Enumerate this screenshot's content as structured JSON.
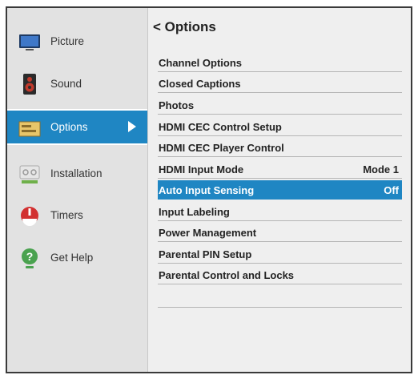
{
  "sidebar": {
    "items": [
      {
        "label": "Picture",
        "icon": "tv-icon",
        "active": false
      },
      {
        "label": "Sound",
        "icon": "speaker-icon",
        "active": false
      },
      {
        "label": "Options",
        "icon": "options-icon",
        "active": true
      },
      {
        "label": "Installation",
        "icon": "installation-icon",
        "active": false
      },
      {
        "label": "Timers",
        "icon": "timer-icon",
        "active": false
      },
      {
        "label": "Get Help",
        "icon": "help-icon",
        "active": false
      }
    ]
  },
  "main": {
    "back_symbol": "<",
    "title": "Options",
    "items": [
      {
        "label": "Channel Options",
        "value": ""
      },
      {
        "label": "Closed Captions",
        "value": ""
      },
      {
        "label": "Photos",
        "value": ""
      },
      {
        "label": "HDMI CEC Control Setup",
        "value": ""
      },
      {
        "label": "HDMI CEC Player Control",
        "value": ""
      },
      {
        "label": "HDMI Input Mode",
        "value": "Mode 1"
      },
      {
        "label": "Auto Input Sensing",
        "value": "Off",
        "selected": true
      },
      {
        "label": "Input Labeling",
        "value": ""
      },
      {
        "label": "Power Management",
        "value": ""
      },
      {
        "label": "Parental PIN Setup",
        "value": ""
      },
      {
        "label": "Parental Control and Locks",
        "value": ""
      }
    ]
  },
  "colors": {
    "accent": "#1f86c3",
    "background": "#efefef",
    "sidebar": "#e2e2e2"
  }
}
